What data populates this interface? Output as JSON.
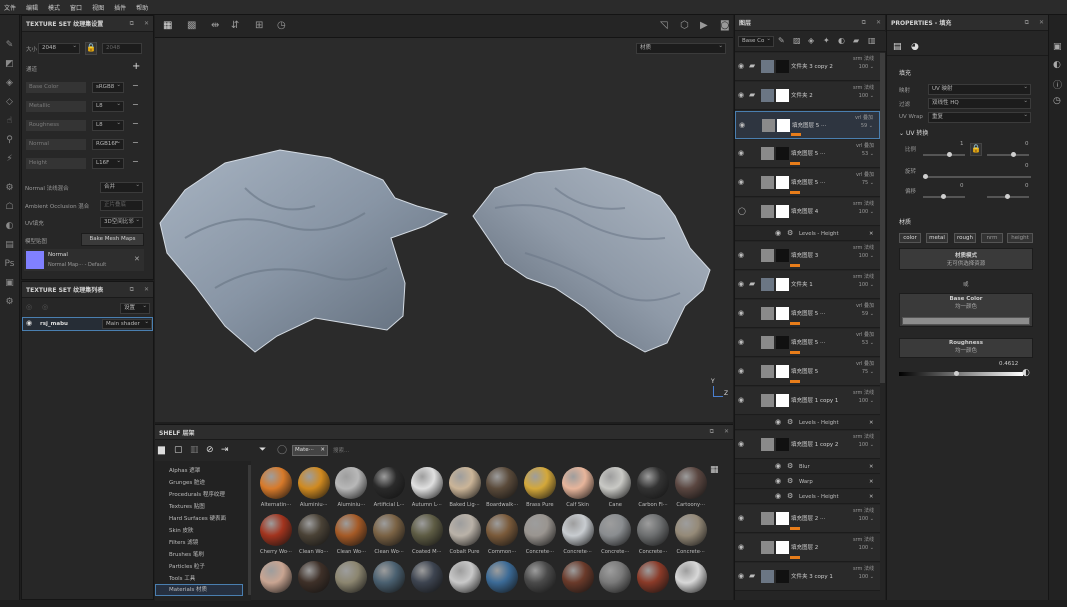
{
  "menu": [
    "文件",
    "编辑",
    "模式",
    "窗口",
    "视图",
    "插件",
    "帮助"
  ],
  "texture_set_settings": {
    "title": "TEXTURE SET 纹理集设置",
    "size_label": "大小",
    "size_value": "2048",
    "size_value2": "2048",
    "channels_label": "通道",
    "channels": [
      {
        "name": "Base Color",
        "format": "sRGB8"
      },
      {
        "name": "Metallic",
        "format": "L8"
      },
      {
        "name": "Roughness",
        "format": "L8"
      },
      {
        "name": "Normal",
        "format": "RGB16F"
      },
      {
        "name": "Height",
        "format": "L16F"
      }
    ],
    "normal_mix_label": "Normal 法线混合",
    "normal_mix_value": "合并",
    "ao_mix_label": "Ambient Occlusion 混合",
    "ao_mix_value": "正片叠底",
    "uv_fill_label": "UV填充",
    "uv_fill_value": "3D空间比邻",
    "mesh_maps_label": "模型贴图",
    "bake_button": "Bake Mesh Maps",
    "normal_map_name": "Normal",
    "normal_map_sub": "Normal Map··· - Default"
  },
  "texture_set_list": {
    "title": "TEXTURE SET 纹理集列表",
    "settings_label": "设置",
    "item_name": "rsj_mabu",
    "item_shader": "Main shader"
  },
  "viewport": {
    "material_dropdown": "材质",
    "axis_y": "Y",
    "axis_z": "Z"
  },
  "shelf": {
    "title": "SHELF 层架",
    "filter_chip": "Mate···",
    "search_placeholder": "搜索...",
    "categories": [
      "Alphas 遮罩",
      "Grunges 脏迹",
      "Procedurals 程序纹理",
      "Textures 贴图",
      "Hard Surfaces 硬表面",
      "Skin 皮肤",
      "Filters 滤镜",
      "Brushes 笔刷",
      "Particles 粒子",
      "Tools 工具",
      "Materials 材质"
    ],
    "materials_row1": [
      {
        "name": "Alternatin···",
        "color": "#d87a2a"
      },
      {
        "name": "Aluminiu···",
        "color": "#d08a20"
      },
      {
        "name": "Aluminiu···",
        "color": "#b8b8b8"
      },
      {
        "name": "Artificial L···",
        "color": "#2a2a2a"
      },
      {
        "name": "Autumn L···",
        "color": "#e0e0e0"
      },
      {
        "name": "Baked Lig···",
        "color": "#cbb598"
      },
      {
        "name": "Boardwalk···",
        "color": "#5a4a3a"
      },
      {
        "name": "Brass Pure",
        "color": "#d4a83a"
      },
      {
        "name": "Calf Skin",
        "color": "#e7b59b"
      },
      {
        "name": "Cane",
        "color": "#c9c9c5"
      },
      {
        "name": "Carbon Fi···",
        "color": "#333"
      },
      {
        "name": "Cartoony···",
        "color": "#5a4640"
      }
    ],
    "materials_row2": [
      {
        "name": "Cherry Wo···",
        "color": "#a2341e"
      },
      {
        "name": "Clean Wo···",
        "color": "#4a4236"
      },
      {
        "name": "Clean Wo···",
        "color": "#a55a26"
      },
      {
        "name": "Clean Wo···",
        "color": "#7a6244"
      },
      {
        "name": "Coated M···",
        "color": "#5e5c44"
      },
      {
        "name": "Cobalt Pure",
        "color": "#bab2a8"
      },
      {
        "name": "Common···",
        "color": "#7a5a3a"
      },
      {
        "name": "Concrete···",
        "color": "#9a9590"
      },
      {
        "name": "Concrete···",
        "color": "#c8ccd0"
      },
      {
        "name": "Concrete···",
        "color": "#8a8d90"
      },
      {
        "name": "Concrete···",
        "color": "#6d6f70"
      },
      {
        "name": "Concrete···",
        "color": "#958a78"
      }
    ],
    "materials_row3": [
      {
        "name": "",
        "color": "#c9a592"
      },
      {
        "name": "",
        "color": "#3e3028"
      },
      {
        "name": "",
        "color": "#8c8670"
      },
      {
        "name": "",
        "color": "#4a6070"
      },
      {
        "name": "",
        "color": "#3d4450"
      },
      {
        "name": "",
        "color": "#c8c8c8"
      },
      {
        "name": "",
        "color": "#3b6a96"
      },
      {
        "name": "",
        "color": "#4a4a4a"
      },
      {
        "name": "",
        "color": "#6a3a2a"
      },
      {
        "name": "",
        "color": "#7a7a7a"
      },
      {
        "name": "",
        "color": "#8a3a28"
      },
      {
        "name": "",
        "color": "#d8d8d8"
      }
    ]
  },
  "layers": {
    "title": "图层",
    "channel_dropdown": "Base Co",
    "items": [
      {
        "name": "文件夹 3 copy 2",
        "blend": "srm 法线",
        "opacity": "100",
        "type": "folder",
        "eye": "◉"
      },
      {
        "name": "文件夹 2",
        "blend": "srm 法线",
        "opacity": "100",
        "type": "folder",
        "eye": "◉"
      },
      {
        "name": "填充图层 5 ···",
        "blend": "vrl 叠加",
        "opacity": "59",
        "type": "fill",
        "eye": "◉"
      },
      {
        "name": "填充图层 5 ···",
        "blend": "vrl 叠加",
        "opacity": "53",
        "type": "fill",
        "eye": "◉"
      },
      {
        "name": "填充图层 5 ···",
        "blend": "vrl 叠加",
        "opacity": "75",
        "type": "fill",
        "eye": "◉"
      },
      {
        "name": "填充图层 4",
        "blend": "srm 法线",
        "opacity": "100",
        "type": "fill",
        "eye": "◯"
      },
      {
        "name": "填充图层 3",
        "blend": "srm 法线",
        "opacity": "100",
        "type": "fill",
        "eye": "◉"
      },
      {
        "name": "文件夹 1",
        "blend": "srm 法线",
        "opacity": "100",
        "type": "folder",
        "eye": "◉"
      },
      {
        "name": "填充图层 5 ···",
        "blend": "vrl 叠加",
        "opacity": "59",
        "type": "fill",
        "eye": "◉"
      },
      {
        "name": "填充图层 5 ···",
        "blend": "vrl 叠加",
        "opacity": "53",
        "type": "fill",
        "eye": "◉"
      },
      {
        "name": "填充图层 5",
        "blend": "vrl 叠加",
        "opacity": "75",
        "type": "fill",
        "eye": "◉"
      },
      {
        "name": "填充图层 1 copy 1",
        "blend": "srm 法线",
        "opacity": "100",
        "type": "fill",
        "eye": "◉"
      },
      {
        "name": "填充图层 1 copy 2",
        "blend": "srm 法线",
        "opacity": "100",
        "type": "fill",
        "eye": "◉"
      },
      {
        "name": "填充图层 2 ···",
        "blend": "srm 法线",
        "opacity": "100",
        "type": "fill",
        "eye": "◉"
      },
      {
        "name": "填充图层 2",
        "blend": "srm 法线",
        "opacity": "100",
        "type": "fill",
        "eye": "◉"
      },
      {
        "name": "文件夹 3 copy 1",
        "blend": "srm 法线",
        "opacity": "100",
        "type": "folder",
        "eye": "◉"
      }
    ],
    "sub_levels_1": "Levels - Height",
    "sub_levels_2": "Levels - Height",
    "sub_blur": "Blur",
    "sub_warp": "Warp",
    "sub_levels_3": "Levels - Height"
  },
  "properties": {
    "title": "PROPERTIES - 填充",
    "fill_label": "填充",
    "mapping_label": "映射",
    "mapping_value": "UV 映射",
    "filter_label": "过滤",
    "filter_value": "双线性 HQ",
    "uvwrap_label": "UV Wrap",
    "uvwrap_value": "重复",
    "uv_transform_label": "UV 转换",
    "scale_label": "比例",
    "scale_value": "1",
    "scale_value2": "0",
    "rotate_label": "旋转",
    "rotate_value": "0",
    "offset_label": "偏移",
    "offset_value": "0",
    "offset_value2": "0",
    "material_label": "材质",
    "channel_tags": [
      "color",
      "metal",
      "rough",
      "nrm",
      "height"
    ],
    "material_mode_title": "材质模式",
    "material_mode_sub": "无可供选择资源",
    "or_label": "或",
    "base_color_title": "Base Color",
    "base_color_sub": "均一颜色",
    "roughness_title": "Roughness",
    "roughness_sub": "均一颜色",
    "roughness_value": "0.4612"
  }
}
